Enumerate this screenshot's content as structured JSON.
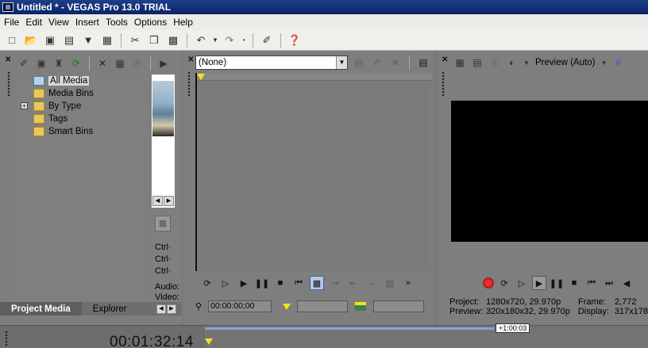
{
  "window": {
    "title": "Untitled * - VEGAS Pro 13.0 TRIAL"
  },
  "menu": [
    "File",
    "Edit",
    "View",
    "Insert",
    "Tools",
    "Options",
    "Help"
  ],
  "toolbar_icons": [
    "new-icon",
    "open-icon",
    "save-icon",
    "save-as-icon",
    "render-icon",
    "properties-icon",
    "cut-icon",
    "copy-icon",
    "paste-icon",
    "undo-icon",
    "redo-icon",
    "history-icon",
    "enable-snapping-icon",
    "whats-this-icon"
  ],
  "project_media": {
    "tree": [
      {
        "label": "All Media",
        "selected": true
      },
      {
        "label": "Media Bins"
      },
      {
        "label": "By Type",
        "expandable": true
      },
      {
        "label": "Tags"
      },
      {
        "label": "Smart Bins"
      }
    ],
    "props_labels": [
      "Ctrl·",
      "Ctrl·",
      "Ctrl·"
    ],
    "audio_label": "Audio:",
    "video_label": "Video:",
    "tabs": [
      "Project Media",
      "Explorer"
    ]
  },
  "trimmer": {
    "select_value": "(None)",
    "timecode": "00:00:00;00"
  },
  "preview": {
    "mode_label": "Preview (Auto)",
    "info": {
      "project_label": "Project:",
      "project_value": "1280x720, 29.970p",
      "preview_label": "Preview:",
      "preview_value": "320x180x32, 29.970p",
      "frame_label": "Frame:",
      "frame_value": "2,772",
      "display_label": "Display:",
      "display_value": "317x178"
    }
  },
  "timeline": {
    "timecode": "00:01:32:14",
    "loop_badge": "+1:00:03"
  }
}
